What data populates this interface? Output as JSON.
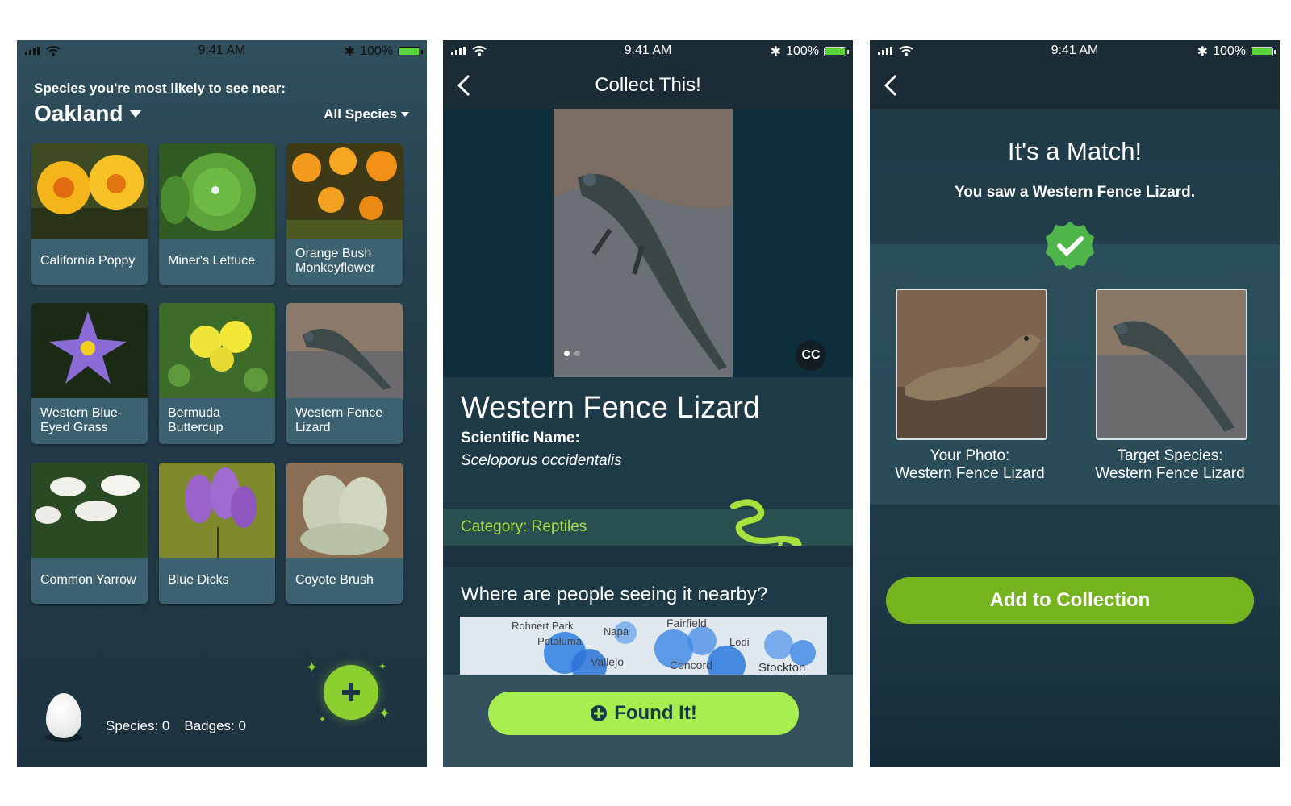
{
  "status": {
    "time": "9:41 AM",
    "battery": "100%"
  },
  "home": {
    "near_label": "Species you're most likely to see near:",
    "city": "Oakland",
    "filter": "All Species",
    "species": [
      {
        "name": "California Poppy"
      },
      {
        "name": "Miner's Lettuce"
      },
      {
        "name": "Orange Bush Monkeyflower"
      },
      {
        "name": "Western Blue-Eyed Grass"
      },
      {
        "name": "Bermuda Buttercup"
      },
      {
        "name": "Western Fence Lizard"
      },
      {
        "name": "Common Yarrow"
      },
      {
        "name": "Blue Dicks"
      },
      {
        "name": "Coyote Brush"
      }
    ],
    "species_count": "Species: 0",
    "badges_count": "Badges: 0",
    "add_icon": "plus-icon"
  },
  "detail": {
    "title": "Collect This!",
    "cc": "CC",
    "species_name": "Western Fence Lizard",
    "sci_label": "Scientific Name:",
    "sci_name": "Sceloporus occidentalis",
    "category": "Category: Reptiles",
    "nearby_heading": "Where are people seeing it nearby?",
    "map_places": [
      "Rohnert Park",
      "Petaluma",
      "Napa",
      "Fairfield",
      "Lodi",
      "Vallejo",
      "Concord",
      "Stockton"
    ],
    "found_button": "Found It!"
  },
  "match": {
    "title": "It's a Match!",
    "subtitle": "You saw a Western Fence Lizard.",
    "your_label_1": "Your Photo:",
    "your_label_2": "Western Fence Lizard",
    "target_label_1": "Target Species:",
    "target_label_2": "Western Fence Lizard",
    "add_button": "Add to Collection"
  },
  "colors": {
    "accent_green": "#a7ef4f",
    "fab_green": "#8bd02e",
    "add_green": "#76b41f",
    "category_text": "#a6e23d"
  }
}
